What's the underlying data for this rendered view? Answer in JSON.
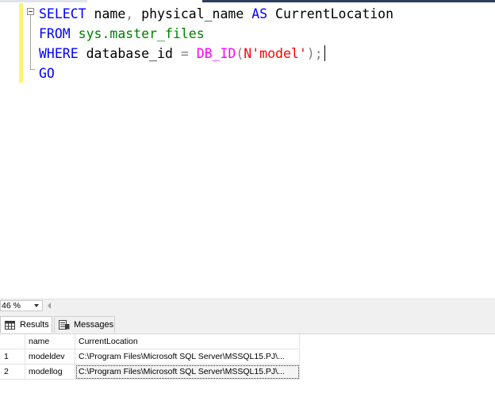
{
  "editor": {
    "lines": [
      {
        "parts": [
          {
            "t": "SELECT",
            "c": "kw"
          },
          {
            "t": " name",
            "c": ""
          },
          {
            "t": ",",
            "c": "gray"
          },
          {
            "t": " physical_name ",
            "c": ""
          },
          {
            "t": "AS",
            "c": "kw"
          },
          {
            "t": " CurrentLocation",
            "c": ""
          }
        ]
      },
      {
        "parts": [
          {
            "t": "FROM",
            "c": "kw"
          },
          {
            "t": " sys.master_files",
            "c": "green"
          }
        ]
      },
      {
        "parts": [
          {
            "t": "WHERE",
            "c": "kw"
          },
          {
            "t": " database_id ",
            "c": ""
          },
          {
            "t": "=",
            "c": "gray"
          },
          {
            "t": " ",
            "c": ""
          },
          {
            "t": "DB_ID",
            "c": "fn"
          },
          {
            "t": "(",
            "c": "gray"
          },
          {
            "t": "N'model'",
            "c": "str"
          },
          {
            "t": ");",
            "c": "gray"
          }
        ],
        "caret": true
      },
      {
        "parts": [
          {
            "t": "GO",
            "c": "kw"
          }
        ]
      }
    ]
  },
  "zoom": {
    "value": "46 %"
  },
  "tabs": {
    "results": "Results",
    "messages": "Messages"
  },
  "grid": {
    "columns": [
      "name",
      "CurrentLocation"
    ],
    "rows": [
      {
        "num": "1",
        "name": "modeldev",
        "location": "C:\\Program Files\\Microsoft SQL Server\\MSSQL15.PJ\\..."
      },
      {
        "num": "2",
        "name": "modellog",
        "location": "C:\\Program Files\\Microsoft SQL Server\\MSSQL15.PJ\\..."
      }
    ]
  }
}
